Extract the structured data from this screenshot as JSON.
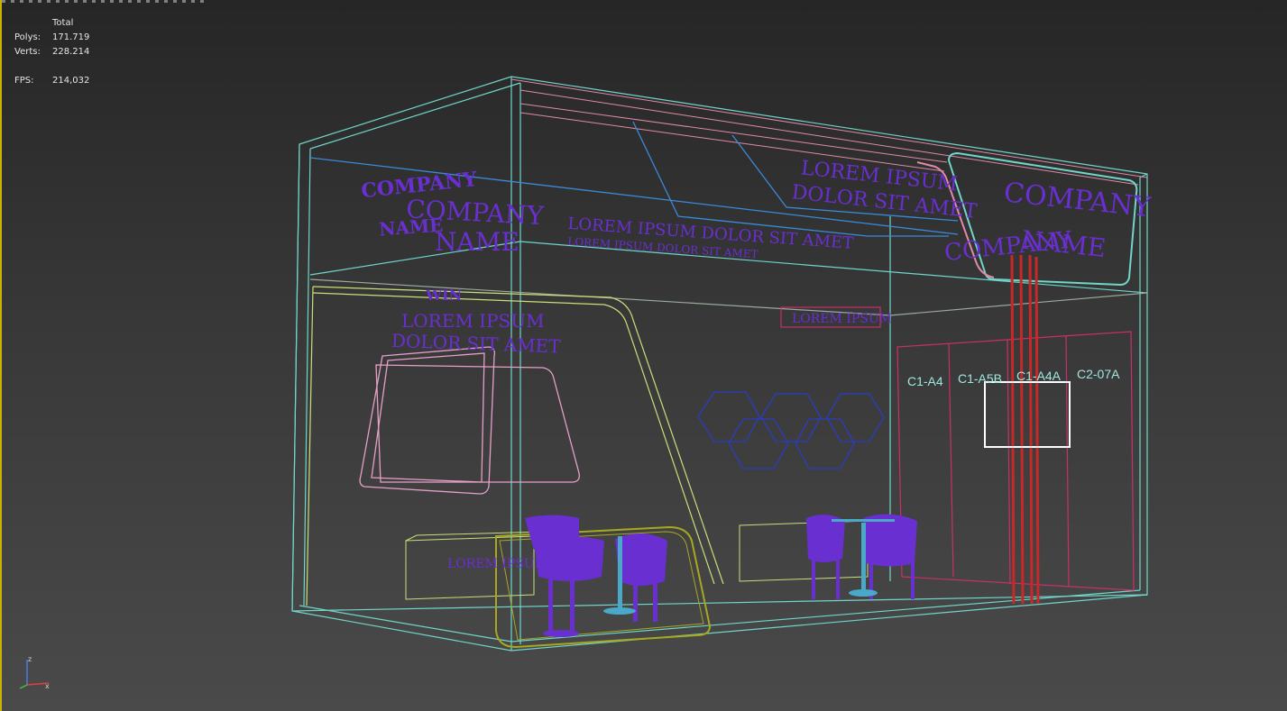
{
  "stats": {
    "header": "Total",
    "polys_label": "Polys:",
    "polys_value": "171.719",
    "verts_label": "Verts:",
    "verts_value": "228.214",
    "fps_label": "FPS:",
    "fps_value": "214,032"
  },
  "scene": {
    "left_logo_line1": "COMPANY",
    "left_logo_line2": "NAME",
    "left_wall_text1": "LOREM IPSUM",
    "left_wall_text2": "DOLOR SIT AMET",
    "header_text1": "LOREM IPSUM DOLOR SIT AMET",
    "header_text2": "LOREM IPSUM DOLOR SIT AMET",
    "right_header1": "LOREM IPSUM",
    "right_header2": "DOLOR SIT AMET",
    "right_logo1": "COMPANY",
    "right_logo2": "NAME",
    "right_logo_alt": "COMPANY",
    "small_sign": "LOREM IPSUM",
    "counter_text": "LOREM IPSUM",
    "door_labels": [
      "C1-A4",
      "C1-A5B",
      "C1-A4A",
      "C2-07A"
    ]
  },
  "colors": {
    "frame": "#6fd6c9",
    "pink": "#e08aa8",
    "purple": "#6a2fd0",
    "yellow_green": "#c8e07a",
    "red": "#c82828",
    "blue": "#2b3cc0",
    "olive": "#a8a820"
  },
  "axis": {
    "z": "z",
    "x": "x",
    "y": "y"
  }
}
